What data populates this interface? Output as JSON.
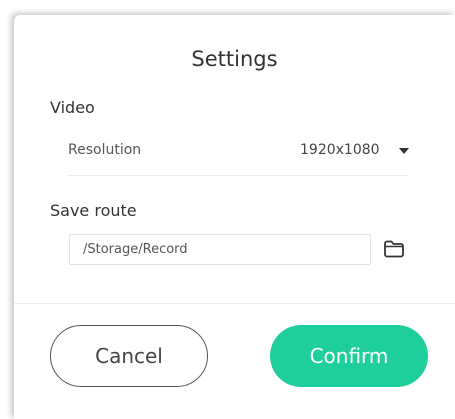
{
  "dialog": {
    "title": "Settings"
  },
  "video": {
    "section_label": "Video",
    "resolution_label": "Resolution",
    "resolution_value": "1920x1080"
  },
  "save_route": {
    "section_label": "Save route",
    "path_value": "/Storage/Record",
    "browse_icon": "folder-icon"
  },
  "buttons": {
    "cancel_label": "Cancel",
    "confirm_label": "Confirm"
  },
  "colors": {
    "confirm_background": "#1fcf9b",
    "text_primary": "#333333"
  }
}
